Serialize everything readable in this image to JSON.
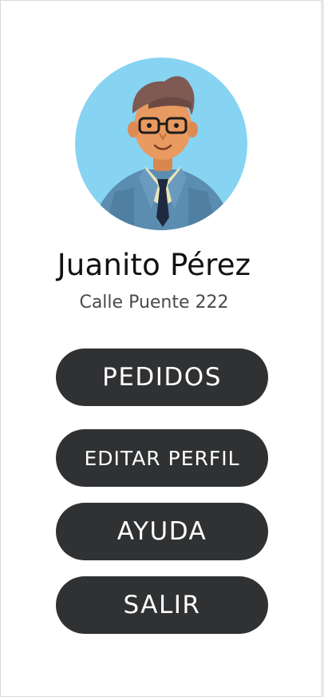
{
  "profile": {
    "name": "Juanito Pérez",
    "address": "Calle Puente 222",
    "avatar_icon": "male-avatar-illustration-icon"
  },
  "menu": {
    "orders_label": "PEDIDOS",
    "edit_profile_label": "EDITAR PERFIL",
    "help_label": "AYUDA",
    "logout_label": "SALIR"
  },
  "colors": {
    "button_background": "#2f3133",
    "button_text": "#ffffff",
    "avatar_background": "#87d3f2"
  }
}
